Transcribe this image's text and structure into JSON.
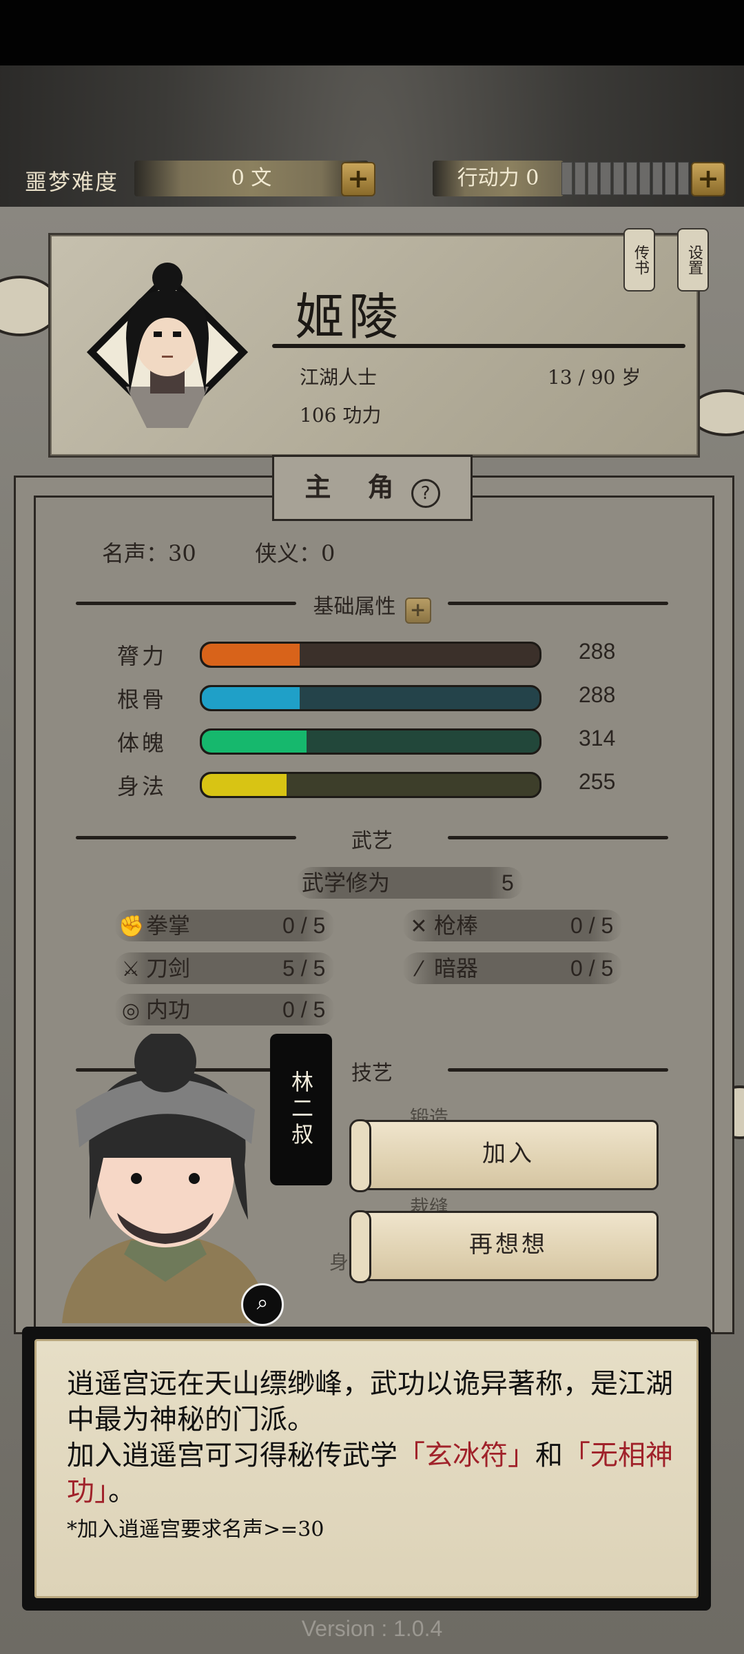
{
  "resources": {
    "nightmare_label": "噩梦难度",
    "coins_value": "0 文",
    "action_label": "行动力 0",
    "action_cells": 10
  },
  "profile": {
    "name": "姬陵",
    "title": "江湖人士",
    "age": "13 / 90 岁",
    "power": "106 功力",
    "btn_letter": "传书",
    "btn_settings": "设置"
  },
  "panel": {
    "tab_label": "主 角",
    "help_icon": "?",
    "fame": "名声：30",
    "chivalry": "侠义：0",
    "attr_section": "基础属性",
    "attributes": [
      {
        "name": "膂力",
        "value": "288",
        "fill": 0.29,
        "color": "#d8631a",
        "track": "#3b302a"
      },
      {
        "name": "根骨",
        "value": "288",
        "fill": 0.29,
        "color": "#1fa0c8",
        "track": "#24434a"
      },
      {
        "name": "体魄",
        "value": "314",
        "fill": 0.31,
        "color": "#16b86d",
        "track": "#22473a"
      },
      {
        "name": "身法",
        "value": "255",
        "fill": 0.25,
        "color": "#d8c414",
        "track": "#3d3e2a"
      }
    ],
    "martial_section": "武艺",
    "martial_cultivation_label": "武学修为",
    "martial_cultivation_value": "5",
    "skills": [
      {
        "name": "拳掌",
        "count": "0 / 5",
        "icon": "fist-icon",
        "glyph": "✊"
      },
      {
        "name": "枪棒",
        "count": "0 / 5",
        "icon": "spear-icon",
        "glyph": "✕"
      },
      {
        "name": "刀剑",
        "count": "5 / 5",
        "icon": "sword-icon",
        "glyph": "⚔"
      },
      {
        "name": "暗器",
        "count": "0 / 5",
        "icon": "dart-icon",
        "glyph": "⁄"
      },
      {
        "name": "内功",
        "count": "0 / 5",
        "icon": "inner-power-icon",
        "glyph": "◎"
      }
    ],
    "craft_section": "技艺",
    "forge_label": "锻造",
    "tailor_label": "裁缝",
    "body_section": "身体"
  },
  "npc": {
    "name": "林二叔"
  },
  "choices": {
    "join": "加入",
    "reconsider": "再想想"
  },
  "dialog": {
    "line1": "逍遥宫远在天山缥缈峰，武功以诡异著称，是江湖中最为神秘的门派。",
    "line2_a": "加入逍遥宫可习得秘传武学",
    "line2_skill1": "「玄冰符」",
    "line2_b": "和",
    "line2_skill2": "「无相神功」",
    "line2_c": "。",
    "note": "*加入逍遥宫要求名声>=30"
  },
  "version": "Version : 1.0.4"
}
